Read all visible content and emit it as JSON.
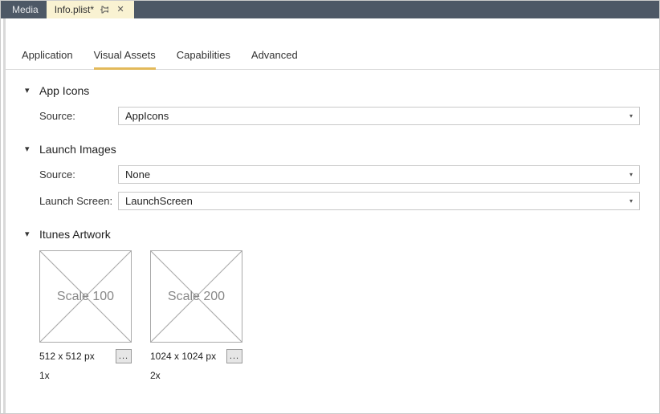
{
  "topTabs": {
    "inactive": "Media",
    "active": "Info.plist*"
  },
  "subTabs": [
    "Application",
    "Visual Assets",
    "Capabilities",
    "Advanced"
  ],
  "appIcons": {
    "title": "App Icons",
    "sourceLabel": "Source:",
    "sourceValue": "AppIcons"
  },
  "launchImages": {
    "title": "Launch Images",
    "sourceLabel": "Source:",
    "sourceValue": "None",
    "launchScreenLabel": "Launch Screen:",
    "launchScreenValue": "LaunchScreen"
  },
  "itunesArtwork": {
    "title": "Itunes Artwork",
    "tiles": [
      {
        "placeholder": "Scale 100",
        "size": "512 x 512 px",
        "scale": "1x"
      },
      {
        "placeholder": "Scale 200",
        "size": "1024 x 1024 px",
        "scale": "2x"
      }
    ],
    "browseLabel": "..."
  }
}
